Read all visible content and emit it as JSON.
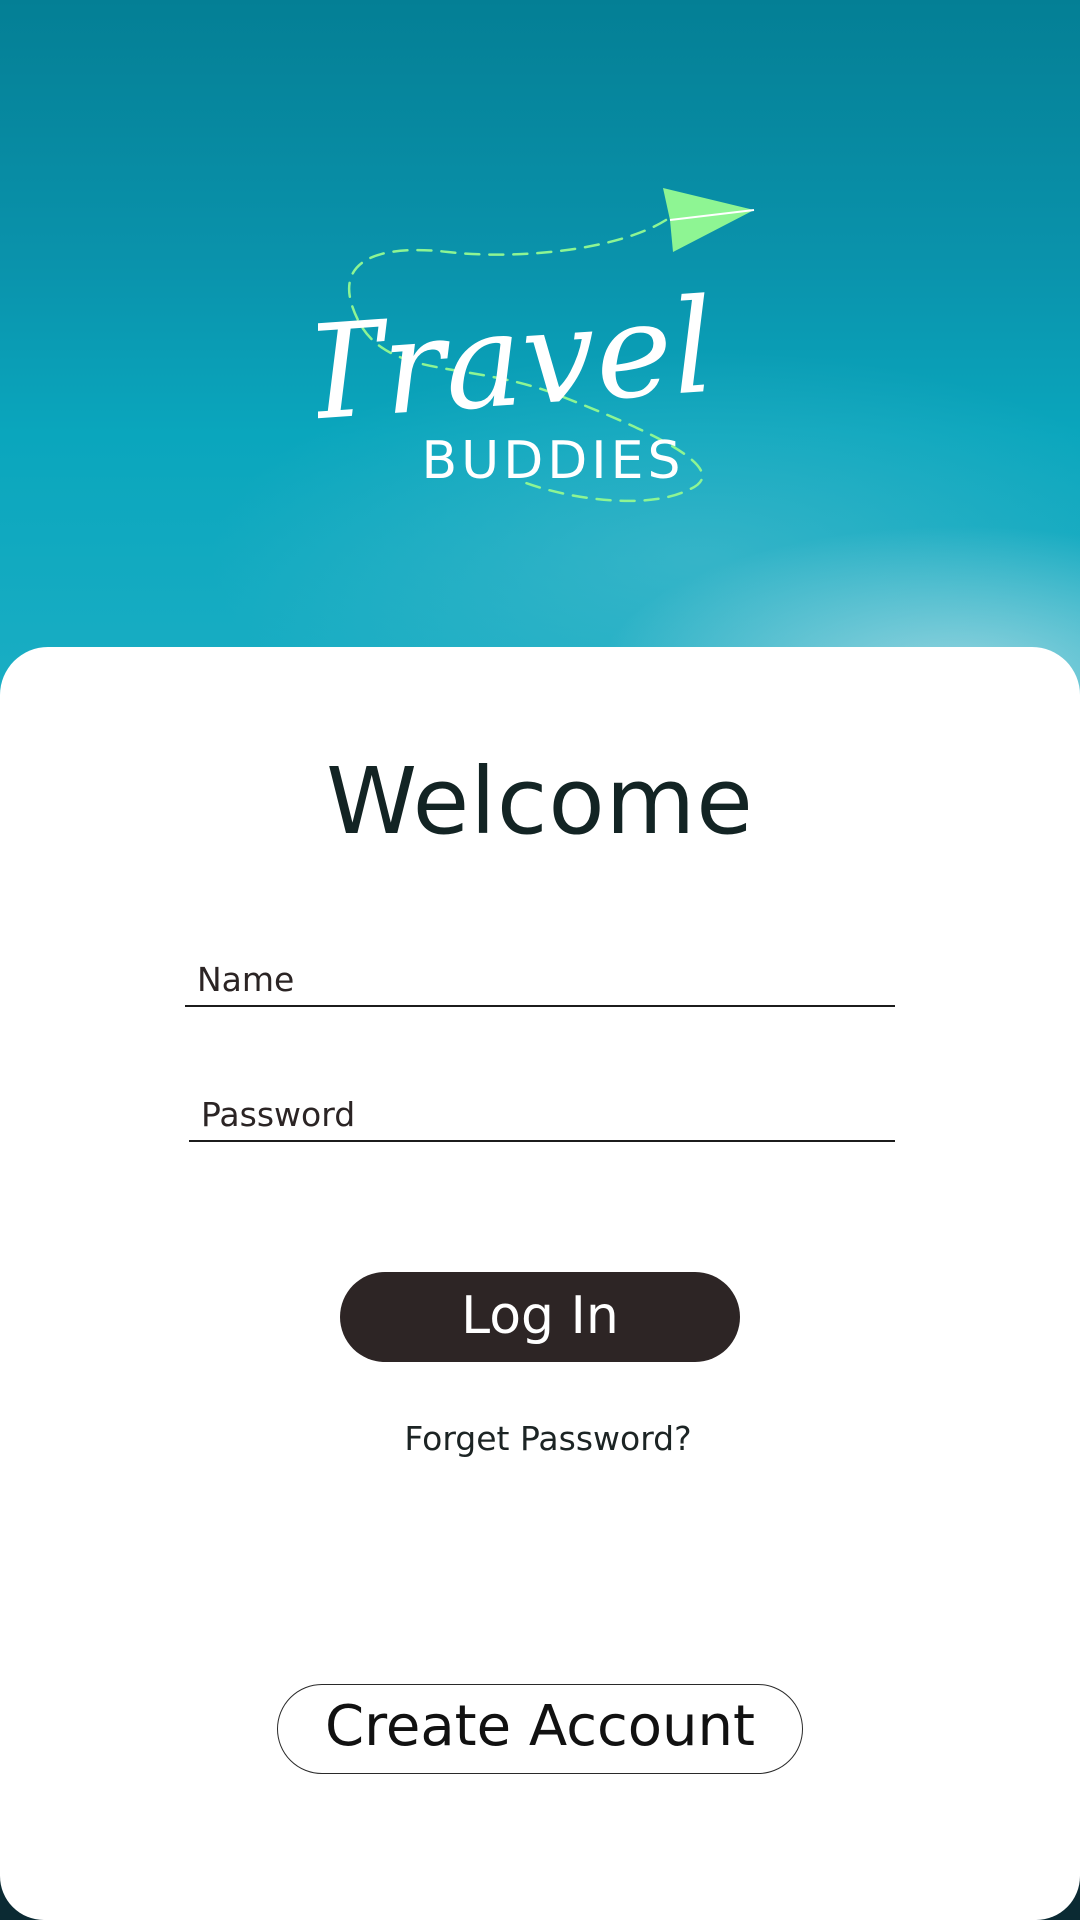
{
  "colors": {
    "sky_top": "#047f95",
    "sky_bottom": "#1aaec4",
    "card_background": "#ffffff",
    "login_button": "#2d2525",
    "logo_plane": "#8ef593",
    "logo_text": "#ffffff"
  },
  "logo": {
    "title": "Travel",
    "subtitle": "BUDDIES",
    "icon": "paper-plane-icon"
  },
  "welcome": {
    "title": "Welcome"
  },
  "form": {
    "name_placeholder": "Name",
    "name_value": "",
    "password_placeholder": "Password",
    "password_value": "",
    "login_label": "Log In",
    "forget_label": "Forget Password?"
  },
  "create_account_label": "Create Account"
}
